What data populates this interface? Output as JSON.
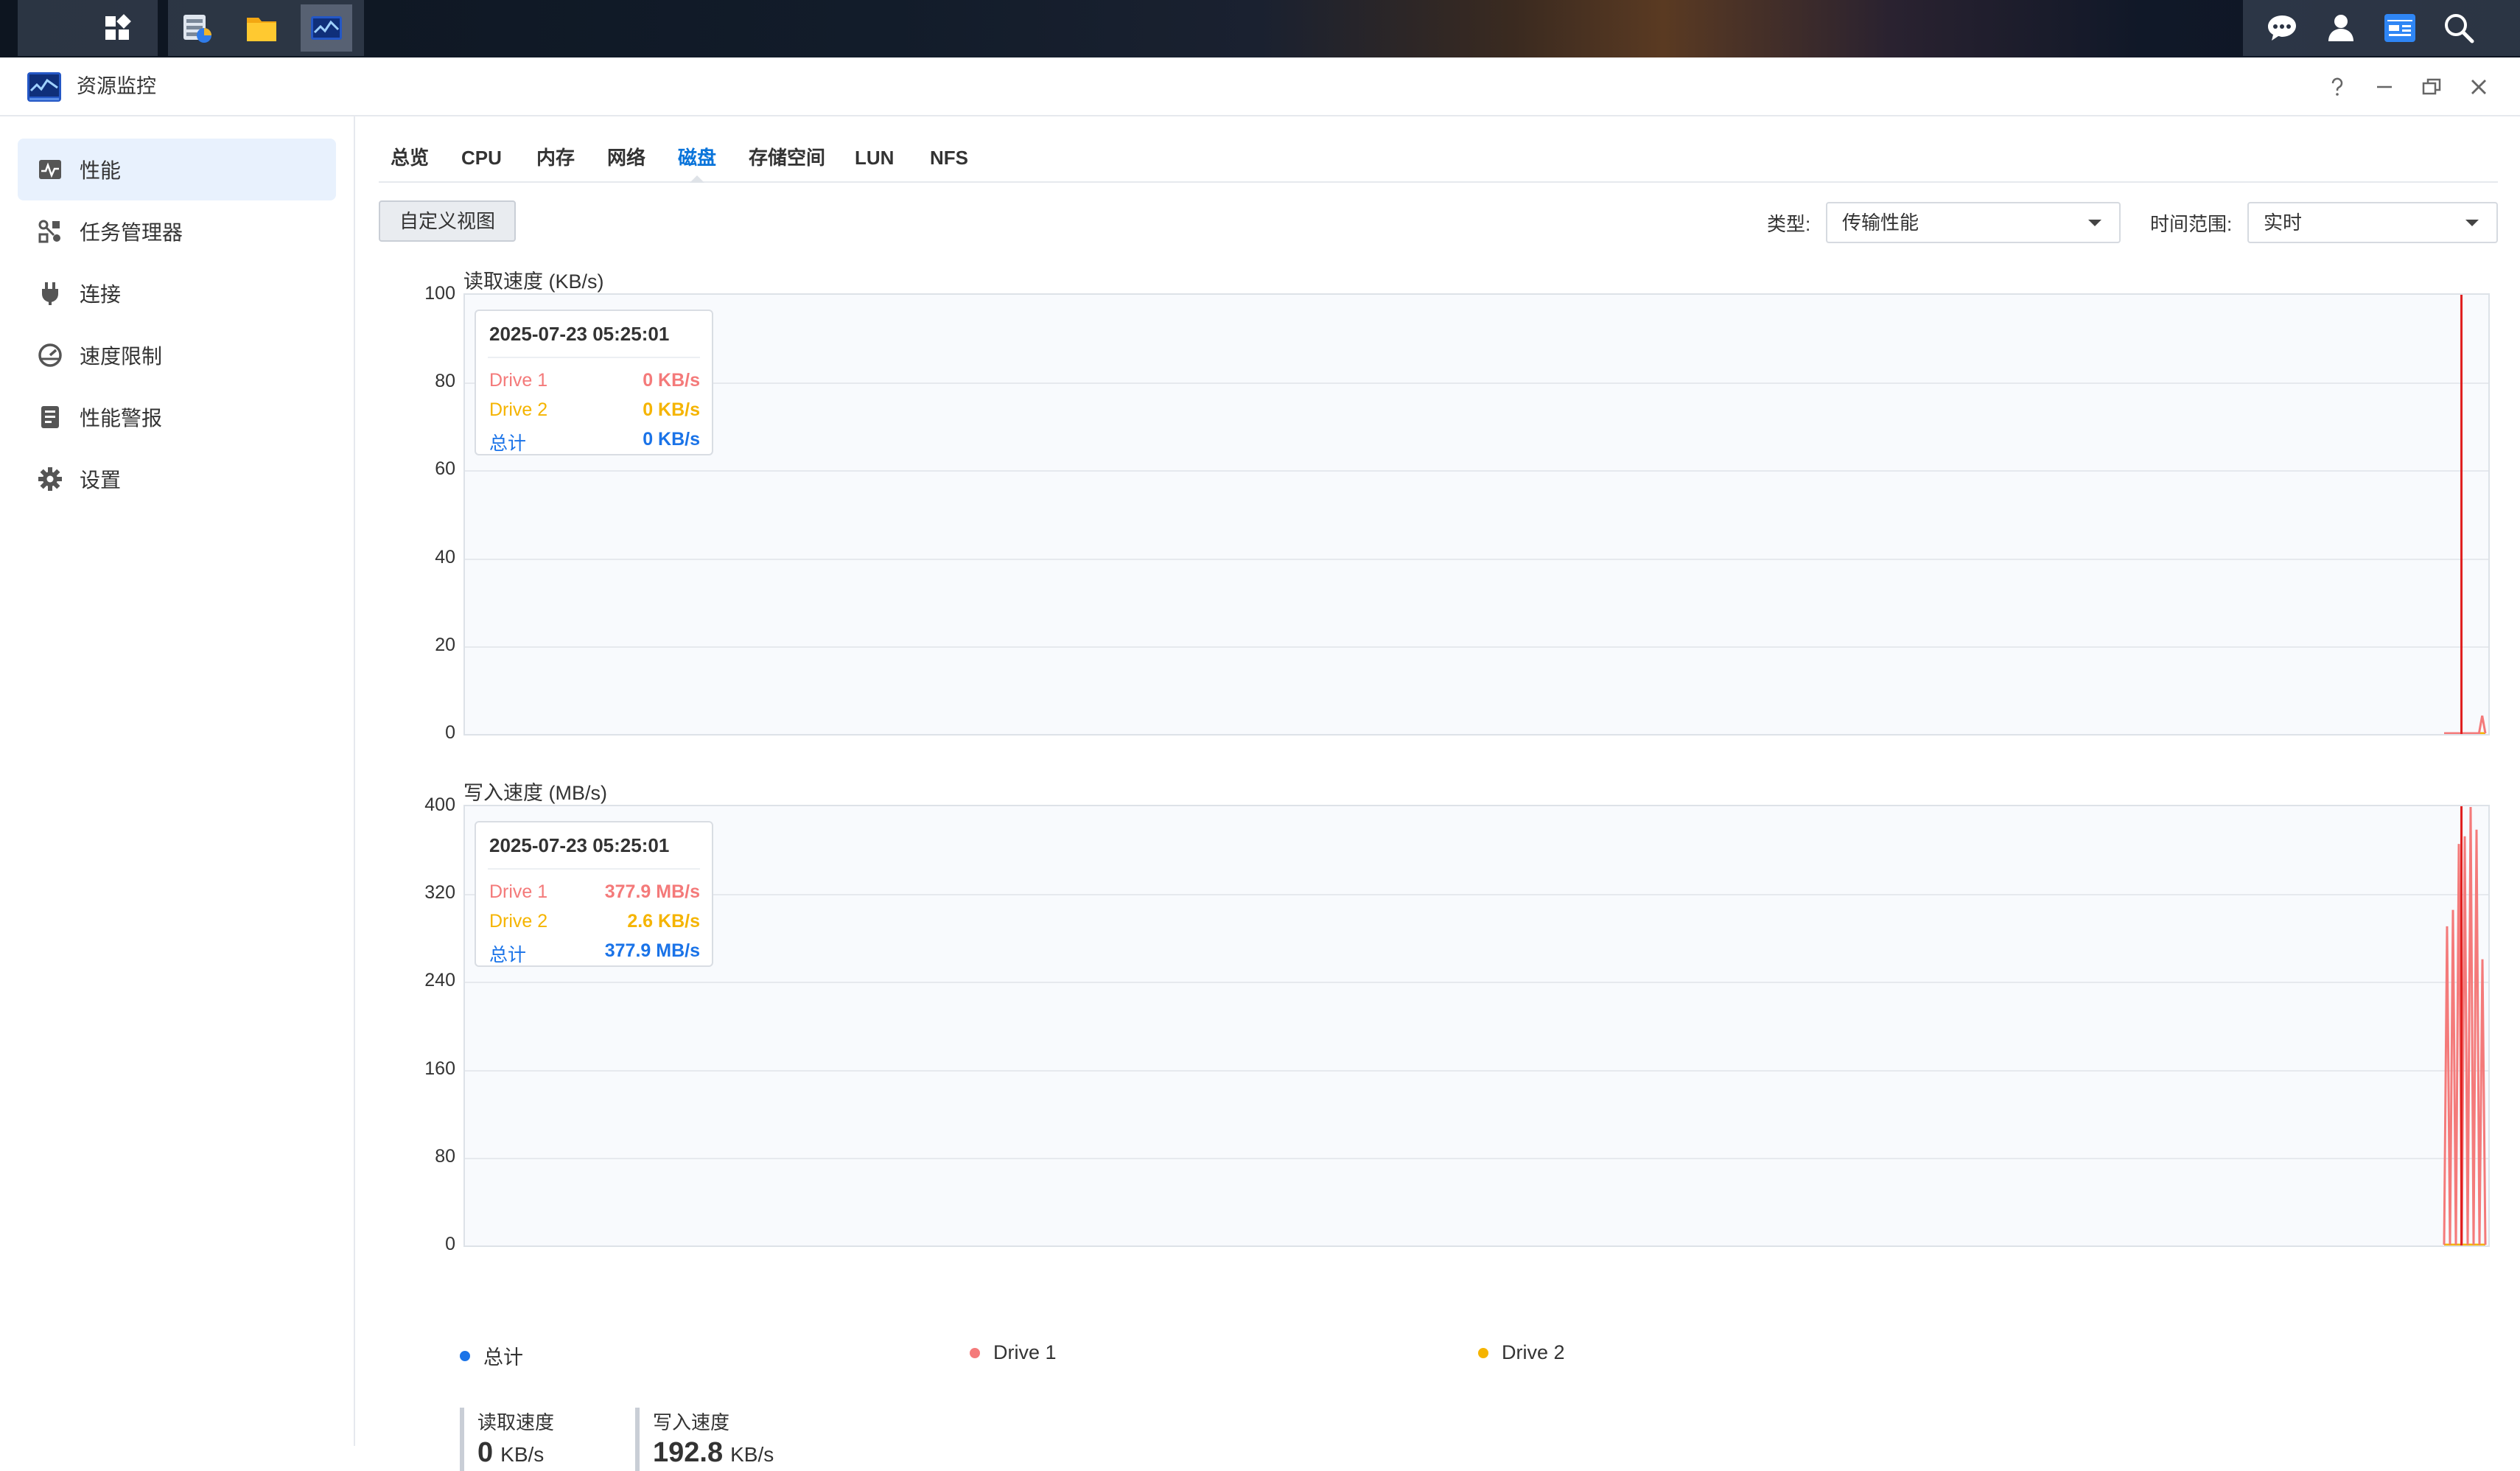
{
  "window": {
    "title": "资源监控",
    "help_icon": "question-icon",
    "minimize_icon": "minimize-icon",
    "restore_icon": "restore-icon",
    "close_icon": "close-icon"
  },
  "taskbar": {
    "left_icons": [
      "main-menu-icon",
      "storage-manager-icon",
      "file-station-icon",
      "resource-monitor-icon"
    ],
    "right_icons": [
      "chat-icon",
      "user-icon",
      "widgets-icon",
      "search-icon"
    ]
  },
  "sidebar": {
    "items": [
      {
        "label": "性能",
        "icon": "performance-icon",
        "active": true
      },
      {
        "label": "任务管理器",
        "icon": "task-manager-icon",
        "active": false
      },
      {
        "label": "连接",
        "icon": "plug-icon",
        "active": false
      },
      {
        "label": "速度限制",
        "icon": "speed-limit-icon",
        "active": false
      },
      {
        "label": "性能警报",
        "icon": "alert-list-icon",
        "active": false
      },
      {
        "label": "设置",
        "icon": "gear-icon",
        "active": false
      }
    ]
  },
  "tabs": [
    {
      "label": "总览",
      "active": false
    },
    {
      "label": "CPU",
      "active": false
    },
    {
      "label": "内存",
      "active": false
    },
    {
      "label": "网络",
      "active": false
    },
    {
      "label": "磁盘",
      "active": true
    },
    {
      "label": "存储空间",
      "active": false
    },
    {
      "label": "LUN",
      "active": false
    },
    {
      "label": "NFS",
      "active": false
    }
  ],
  "toolbar": {
    "custom_view_label": "自定义视图",
    "type_label": "类型:",
    "type_value": "传输性能",
    "range_label": "时间范围:",
    "range_value": "实时"
  },
  "colors": {
    "total": "#1a73e8",
    "drive1": "#f47a7a",
    "drive2": "#f5b400",
    "accent": "#0a74da"
  },
  "chart_data": [
    {
      "type": "line",
      "title": "读取速度 (KB/s)",
      "ylim": [
        0,
        100
      ],
      "yticks": [
        "100",
        "80",
        "60",
        "40",
        "20",
        "0"
      ],
      "grid": true,
      "series": [
        {
          "name": "Drive 1",
          "color": "#f47a7a",
          "values": [
            0,
            0,
            0,
            0,
            0,
            0,
            0,
            0,
            0,
            0,
            0,
            0,
            4,
            0
          ]
        },
        {
          "name": "Drive 2",
          "color": "#f5b400",
          "values": [
            0,
            0,
            0,
            0,
            0,
            0,
            0,
            0,
            0,
            0,
            0,
            0,
            0,
            0
          ]
        }
      ],
      "tooltip": {
        "time": "2025-07-23 05:25:01",
        "rows": [
          {
            "name": "Drive 1",
            "value": "0 KB/s",
            "color": "#f47a7a"
          },
          {
            "name": "Drive 2",
            "value": "0 KB/s",
            "color": "#f5b400"
          },
          {
            "name": "总计",
            "value": "0 KB/s",
            "color": "#1a73e8"
          }
        ]
      }
    },
    {
      "type": "line",
      "title": "写入速度 (MB/s)",
      "ylim": [
        0,
        400
      ],
      "yticks": [
        "400",
        "320",
        "240",
        "160",
        "80",
        "0"
      ],
      "grid": true,
      "series": [
        {
          "name": "Drive 1",
          "color": "#f47a7a",
          "values": [
            0,
            290,
            0,
            305,
            0,
            365,
            0,
            372,
            0,
            400,
            0,
            378,
            0,
            260,
            0
          ]
        },
        {
          "name": "Drive 2",
          "color": "#f5b400",
          "values": [
            0,
            0,
            0,
            0,
            0,
            0,
            0,
            0,
            0,
            0,
            0,
            0,
            0,
            0,
            0
          ]
        }
      ],
      "tooltip": {
        "time": "2025-07-23 05:25:01",
        "rows": [
          {
            "name": "Drive 1",
            "value": "377.9 MB/s",
            "color": "#f47a7a"
          },
          {
            "name": "Drive 2",
            "value": "2.6 KB/s",
            "color": "#f5b400"
          },
          {
            "name": "总计",
            "value": "377.9 MB/s",
            "color": "#1a73e8"
          }
        ]
      }
    }
  ],
  "legend": [
    {
      "name": "总计",
      "color": "#1a73e8"
    },
    {
      "name": "Drive 1",
      "color": "#f47a7a"
    },
    {
      "name": "Drive 2",
      "color": "#f5b400"
    }
  ],
  "stats": [
    {
      "label": "读取速度",
      "value": "0",
      "unit": "KB/s"
    },
    {
      "label": "写入速度",
      "value": "192.8",
      "unit": "KB/s"
    }
  ]
}
